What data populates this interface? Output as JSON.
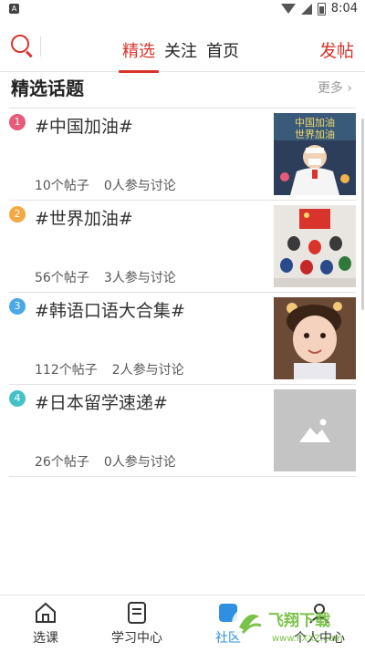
{
  "status": {
    "time": "8:04",
    "app_badge": "A"
  },
  "header": {
    "tabs": [
      "精选",
      "关注",
      "首页"
    ],
    "active_tab": 0,
    "post_label": "发帖"
  },
  "section": {
    "title": "精选话题",
    "more_label": "更多"
  },
  "topics": [
    {
      "rank": "1",
      "title": "#中国加油#",
      "posts": "10个帖子",
      "discuss": "0人参与讨论",
      "rank_color": "#e85a7a",
      "thumb_text": "中国加油 世界加油"
    },
    {
      "rank": "2",
      "title": "#世界加油#",
      "posts": "56个帖子",
      "discuss": "3人参与讨论",
      "rank_color": "#f5a843"
    },
    {
      "rank": "3",
      "title": "#韩语口语大合集#",
      "posts": "112个帖子",
      "discuss": "2人参与讨论",
      "rank_color": "#4aa8e8"
    },
    {
      "rank": "4",
      "title": "#日本留学速递#",
      "posts": "26个帖子",
      "discuss": "0人参与讨论",
      "rank_color": "#45c2c8"
    }
  ],
  "bottom_nav": [
    {
      "label": "选课",
      "icon": "home-icon"
    },
    {
      "label": "学习中心",
      "icon": "document-icon"
    },
    {
      "label": "社区",
      "icon": "community-icon"
    },
    {
      "label": "个人中心",
      "icon": "profile-icon"
    }
  ],
  "watermark": {
    "text": "飞翔下载",
    "url_text": "www.FXXZ.com"
  }
}
